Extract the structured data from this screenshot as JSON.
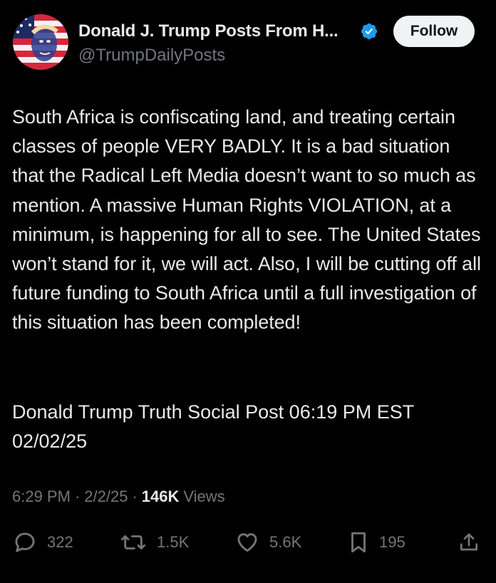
{
  "author": {
    "name": "Donald J. Trump Posts From H...",
    "handle": "@TrumpDailyPosts",
    "verified": true,
    "avatar_icon": "flag-portrait-avatar"
  },
  "follow_label": "Follow",
  "post": {
    "text": "South Africa is confiscating land, and treating certain classes of people VERY BADLY. It is a bad situation that the Radical Left Media doesn’t want to so much as mention. A massive Human Rights VIOLATION, at a minimum, is happening for all to see. The United States won’t stand for it, we will act. Also, I will be cutting off all future funding to South Africa until a full investigation of this situation has been completed!",
    "source_line": "Donald Trump Truth Social Post 06:19 PM EST 02/02/25"
  },
  "meta": {
    "time": "6:29 PM",
    "separator": "·",
    "date": "2/2/25",
    "views_count": "146K",
    "views_label": "Views"
  },
  "actions": {
    "replies": "322",
    "reposts": "1.5K",
    "likes": "5.6K",
    "bookmarks": "195"
  },
  "colors": {
    "background": "#000000",
    "text_primary": "#e7e9ea",
    "text_secondary": "#71767b",
    "verified_blue": "#1d9bf0",
    "follow_bg": "#eff3f4"
  }
}
